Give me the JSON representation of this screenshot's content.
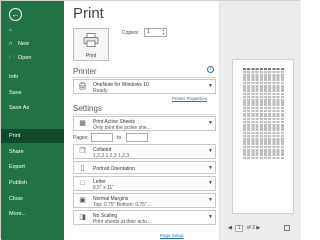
{
  "nav": {
    "items": [
      {
        "label": "New",
        "icon": "new-icon"
      },
      {
        "label": "Open",
        "icon": "open-icon"
      },
      {
        "label": "Info"
      },
      {
        "label": "Save"
      },
      {
        "label": "Save As"
      },
      {
        "label": "Print"
      },
      {
        "label": "Share"
      },
      {
        "label": "Export"
      },
      {
        "label": "Publish"
      },
      {
        "label": "Close"
      },
      {
        "label": "More..."
      }
    ],
    "home_label": "",
    "active": "Print",
    "accent": "#217346"
  },
  "main": {
    "title": "Print",
    "print_button_label": "Print",
    "copies_label": "Copies:",
    "copies_value": "1",
    "printer": {
      "heading": "Printer",
      "name": "OneNote for Windows 10",
      "status": "Ready",
      "properties_link": "Printer Properties"
    },
    "settings": {
      "heading": "Settings",
      "what": {
        "line1": "Print Active Sheets",
        "line2": "Only print the active she..."
      },
      "pages_label": "Pages:",
      "to_label": "to",
      "collate": {
        "line1": "Collated",
        "line2": "1,2,3    1,2,3    1,2,3"
      },
      "orientation": {
        "line1": "Portrait Orientation"
      },
      "paper": {
        "line1": "Letter",
        "line2": "8.5\" x 11\""
      },
      "margins": {
        "line1": "Normal Margins",
        "line2": "Top: 0.75\" Bottom: 0.75\"..."
      },
      "scaling": {
        "line1": "No Scaling",
        "line2": "Print sheets at their actu..."
      },
      "page_setup_link": "Page Setup"
    }
  },
  "preview": {
    "current_page": "1",
    "of_label": "of 2"
  }
}
